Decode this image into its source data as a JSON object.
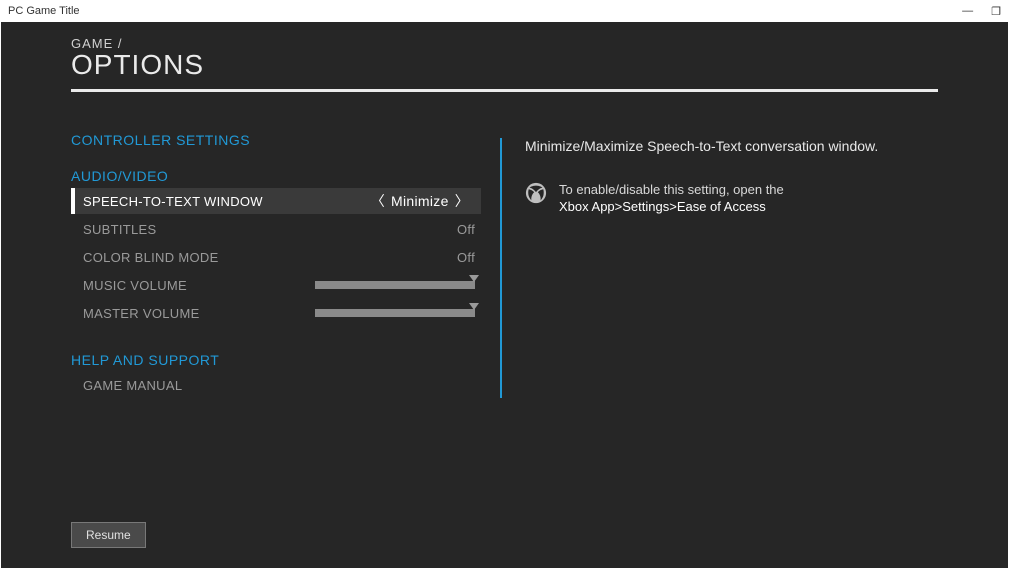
{
  "window": {
    "title": "PC Game Title",
    "minimize_glyph": "—",
    "restore_glyph": "❐"
  },
  "breadcrumb": "GAME  /",
  "page_title": "OPTIONS",
  "sections": {
    "controller": {
      "header": "CONTROLLER SETTINGS"
    },
    "av": {
      "header": "AUDIO/VIDEO",
      "items": {
        "stt": {
          "label": "SPEECH-TO-TEXT WINDOW",
          "value": "Minimize"
        },
        "subtitles": {
          "label": "SUBTITLES",
          "value": "Off"
        },
        "colorblind": {
          "label": "COLOR BLIND MODE",
          "value": "Off"
        },
        "music_volume": {
          "label": "MUSIC VOLUME"
        },
        "master_volume": {
          "label": "MASTER VOLUME"
        }
      }
    },
    "help": {
      "header": "HELP AND SUPPORT",
      "manual": {
        "label": "GAME MANUAL"
      }
    }
  },
  "detail": {
    "description": "Minimize/Maximize Speech-to-Text conversation window.",
    "helper_line": "To enable/disable this setting, open the",
    "helper_path": "Xbox App>Settings>Ease of Access"
  },
  "footer": {
    "resume": "Resume"
  },
  "icons": {
    "chevron_left": "〈",
    "chevron_right": "〉"
  }
}
